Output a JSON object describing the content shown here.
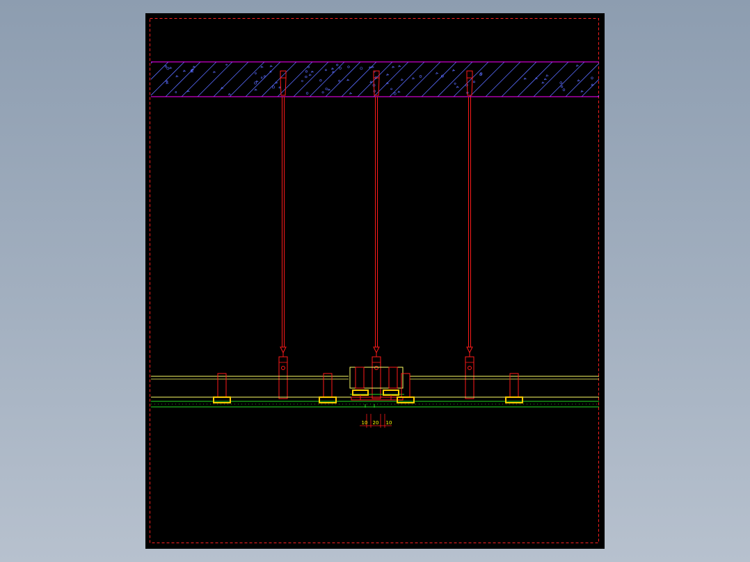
{
  "dimensions": {
    "left": "10",
    "middle": "20",
    "right": "10"
  },
  "colors": {
    "background": "#8d9db0",
    "sheet": "#000000",
    "frame": "#ff2020",
    "slab_outline": "#ff00ff",
    "hatch": "#5a6cff",
    "hanger": "#ff1a1a",
    "panel_line": "#ffff66",
    "gasket": "#ffcc00",
    "glass_line": "#22dd22",
    "dimension_text": "#ffff00"
  }
}
